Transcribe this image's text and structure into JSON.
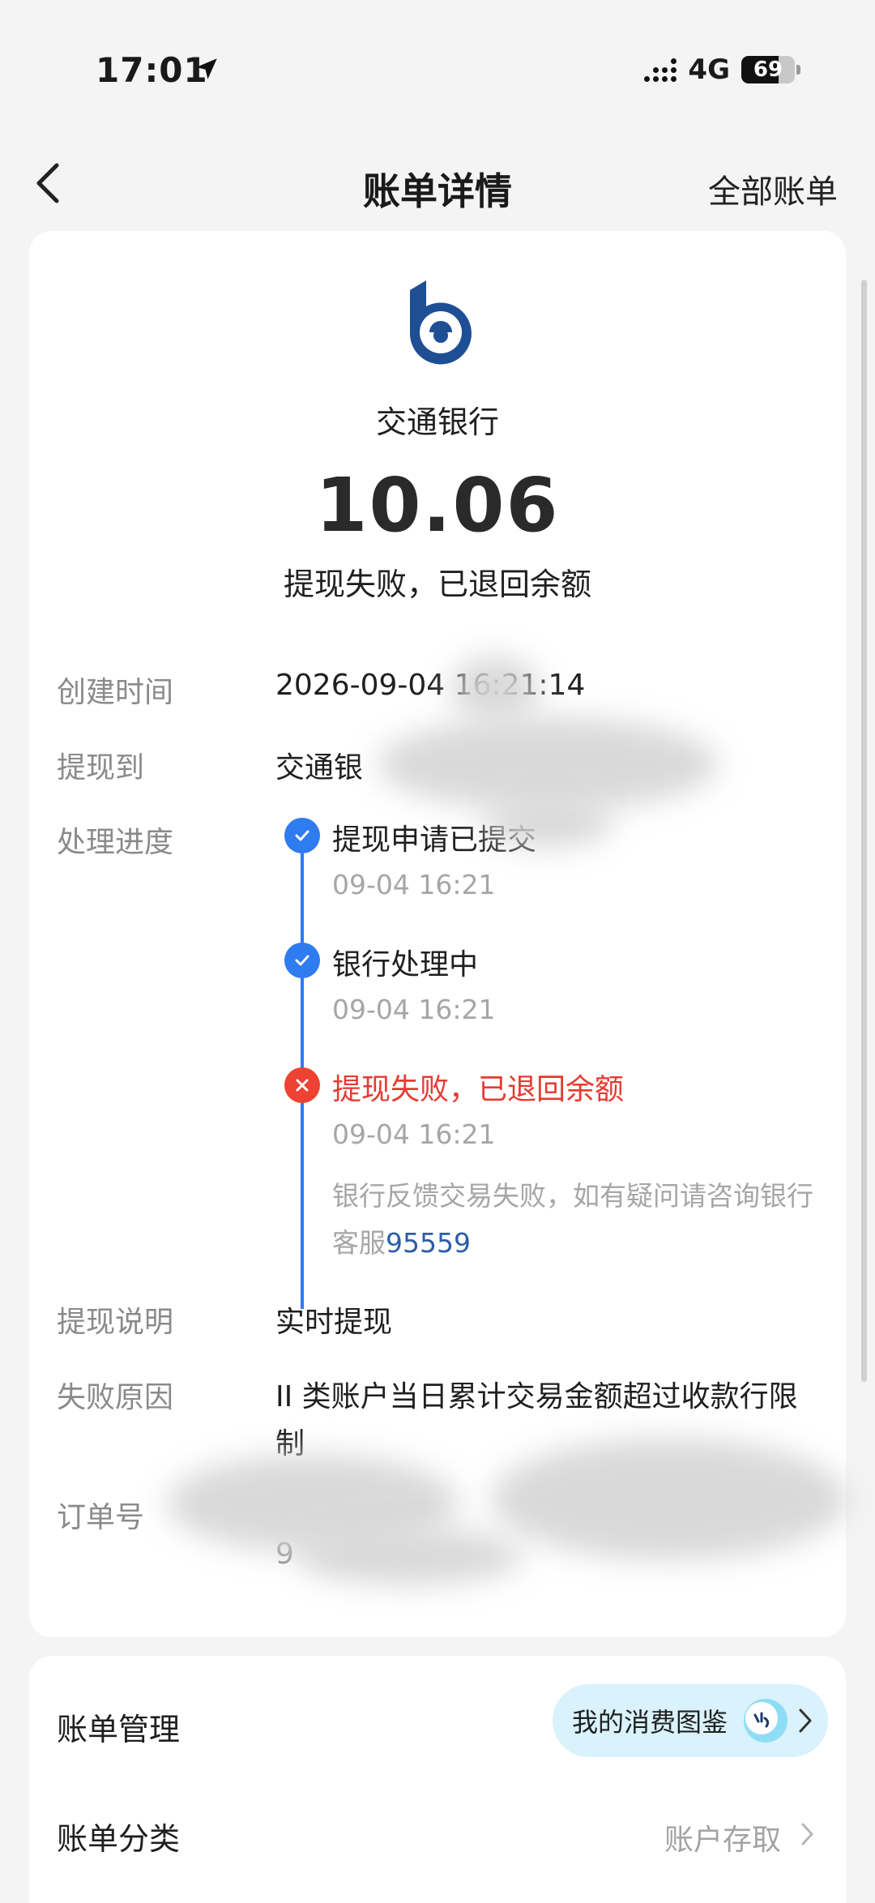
{
  "status_bar": {
    "time": "17:01",
    "network": "4G",
    "battery": "69",
    "battery_level": 0.69
  },
  "nav": {
    "title": "账单详情",
    "right_link": "全部账单"
  },
  "bill": {
    "bank_name": "交通银行",
    "amount": "10.06",
    "status": "提现失败，已退回余额",
    "created_label": "创建时间",
    "created_value": "2026-09-04 16:21:14",
    "withdraw_to_label": "提现到",
    "withdraw_to_value": "交通银",
    "progress_label": "处理进度",
    "progress": [
      {
        "title": "提现申请已提交",
        "time": "09-04 16:21",
        "state": "done"
      },
      {
        "title": "银行处理中",
        "time": "09-04 16:21",
        "state": "done"
      },
      {
        "title": "提现失败，已退回余额",
        "time": "09-04 16:21",
        "state": "failed"
      }
    ],
    "failure_note": "银行反馈交易失败，如有疑问请咨询银行客服",
    "failure_phone": "95559",
    "desc_label": "提现说明",
    "desc_value": "实时提现",
    "reason_label": "失败原因",
    "reason_value": "II 类账户当日累计交易金额超过收款行限制",
    "order_label": "订单号",
    "order_value": "9"
  },
  "manage": {
    "title": "账单管理",
    "consume_button": "我的消费图鉴",
    "category_label": "账单分类",
    "category_value": "账户存取"
  },
  "colors": {
    "accent_blue": "#2f7bf0",
    "fail_red": "#e63a32",
    "bank_blue": "#1e4f95"
  }
}
